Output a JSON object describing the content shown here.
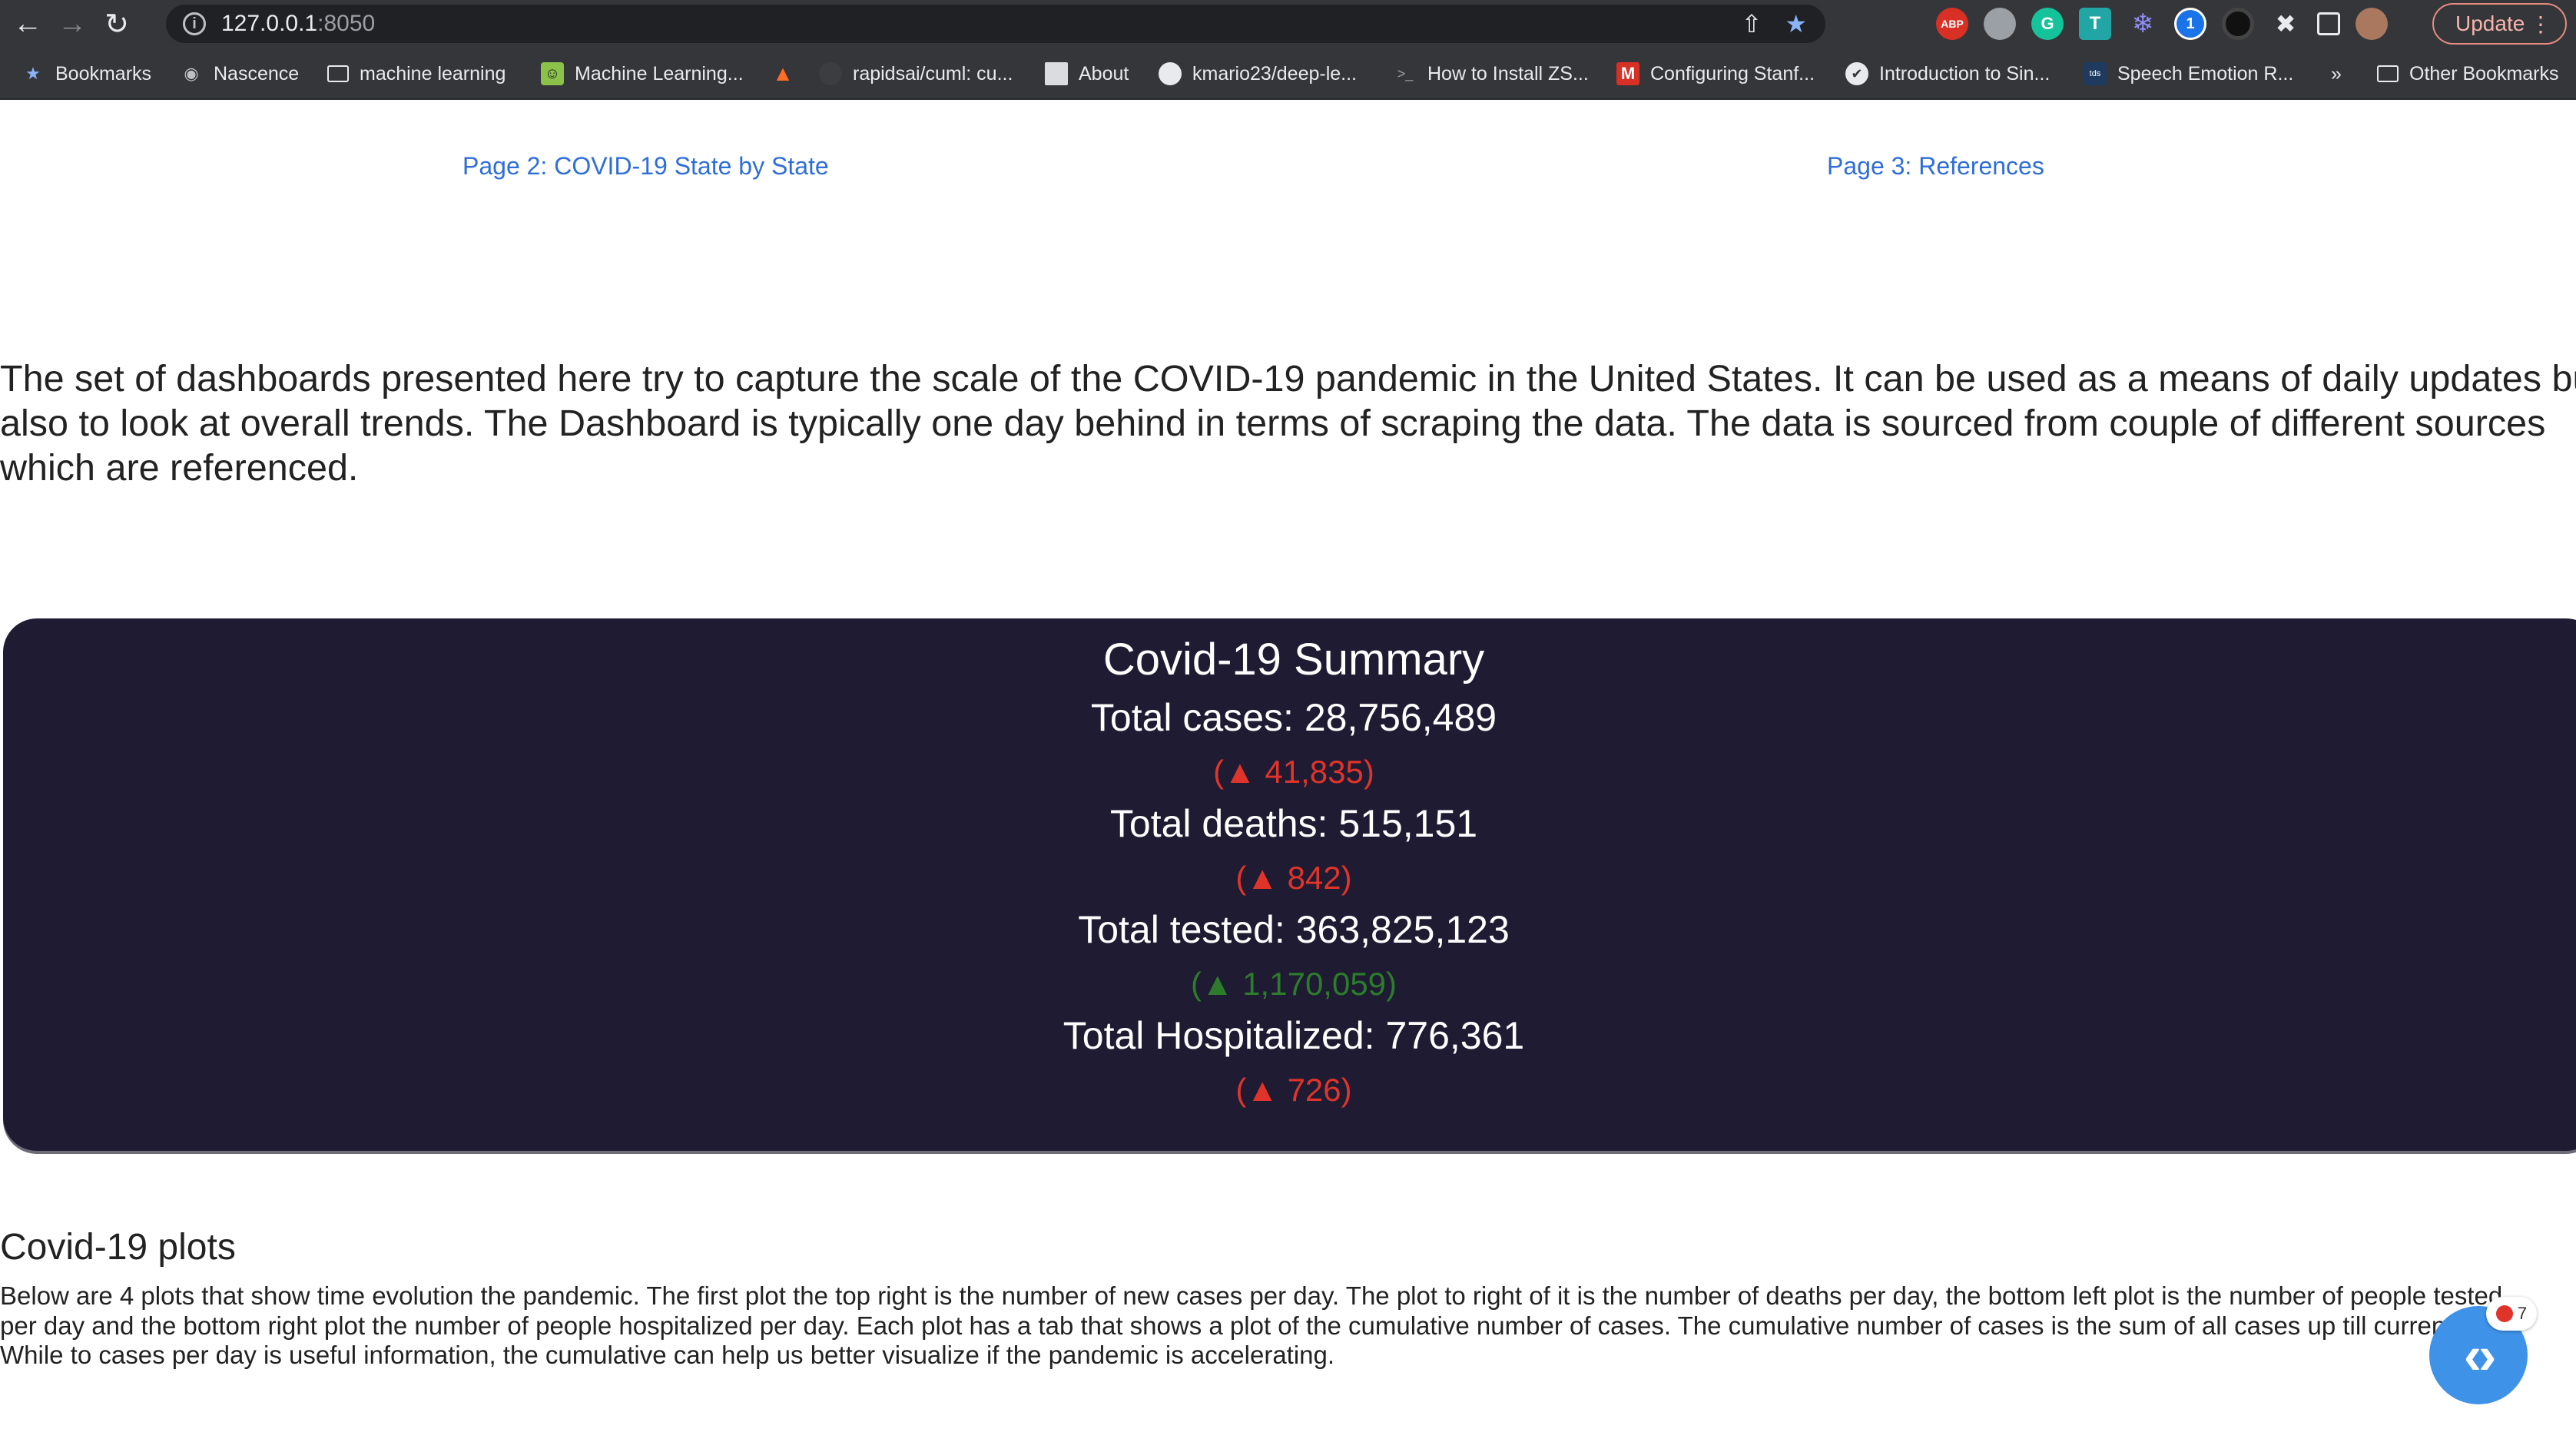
{
  "browser": {
    "url_host": "127.0.0.1",
    "url_port": ":8050",
    "update_label": "Update",
    "bookmarks": [
      {
        "label": "Bookmarks",
        "icon": "star-icon"
      },
      {
        "label": "Nascence",
        "icon": "globe-icon"
      },
      {
        "label": "machine learning",
        "icon": "folder-icon"
      },
      {
        "label": "Machine Learning...",
        "icon": "smiley-icon"
      },
      {
        "label": "",
        "icon": "gitlab-icon"
      },
      {
        "label": "rapidsai/cuml: cu...",
        "icon": "github-icon"
      },
      {
        "label": "About",
        "icon": "page-icon"
      },
      {
        "label": "kmario23/deep-le...",
        "icon": "github-icon"
      },
      {
        "label": "How to Install ZS...",
        "icon": "terminal-icon"
      },
      {
        "label": "Configuring Stanf...",
        "icon": "gmail-icon"
      },
      {
        "label": "Introduction to Sin...",
        "icon": "bird-icon"
      },
      {
        "label": "Speech Emotion R...",
        "icon": "tds-icon"
      },
      {
        "label": "»",
        "icon": ""
      },
      {
        "label": "Other Bookmarks",
        "icon": "folder-icon"
      }
    ],
    "extensions": {
      "abp": "ABP",
      "grammarly": "G",
      "t_ext": "T",
      "onepass": "1",
      "tds_badge": "tds"
    }
  },
  "nav": {
    "page2": "Page 2: COVID-19 State by State",
    "page3": "Page 3: References"
  },
  "intro": {
    "line1": "The set of dashboards presented here try to capture the scale of the COVID-19 pandemic in the United States. It can be used as a means of daily updates but",
    "line2": "also to look at overall trends. The Dashboard is typically one day behind in terms of scraping the data. The data is sourced from couple of different sources",
    "line3": "which are referenced."
  },
  "summary": {
    "title": "Covid-19 Summary",
    "cases": "Total cases: 28,756,489",
    "cases_delta": "(▲ 41,835)",
    "deaths": "Total deaths: 515,151",
    "deaths_delta": "(▲ 842)",
    "tested": "Total tested: 363,825,123",
    "tested_delta": "(▲ 1,170,059)",
    "hosp": "Total Hospitalized: 776,361",
    "hosp_delta": "(▲ 726)",
    "colors": {
      "background": "#1e1b33",
      "increase_bad": "#e0342a",
      "increase_good": "#2d7c2b"
    }
  },
  "plots": {
    "heading": "Covid-19 plots",
    "line1": "Below are 4 plots that show time evolution the pandemic. The first plot the top right is the number of new cases per day. The plot to right of it is the number of deaths per day, the bottom left plot is the number of people tested",
    "line2": "per day and the bottom right plot the number of people hospitalized per day. Each plot has a tab that shows a plot of the cumulative number of cases. The cumulative number of cases is the sum of all cases up till current date.",
    "line3": "While to cases per day is useful information, the cumulative can help us better visualize if the pandemic is accelerating."
  },
  "debug": {
    "badge_count": "7",
    "fab_icon": "code-icon"
  }
}
